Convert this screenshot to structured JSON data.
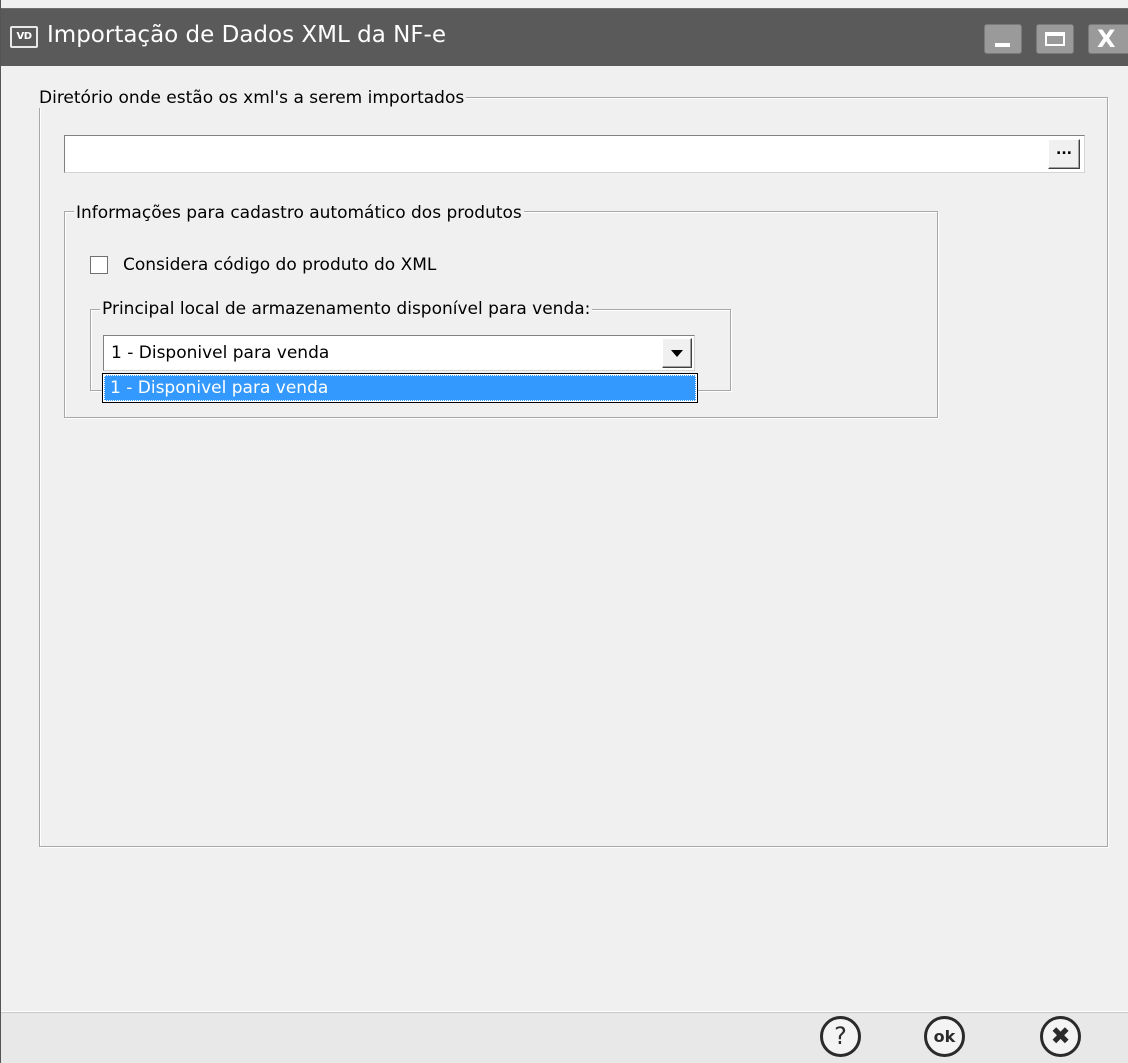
{
  "window": {
    "app_icon_text": "VD",
    "title": "Importação de Dados XML da NF-e",
    "close_glyph": "X"
  },
  "directory_group": {
    "legend": "Diretório onde estão os xml's a serem importados",
    "path_value": "",
    "browse_label": "..."
  },
  "products_group": {
    "legend": "Informações para cadastro automático dos produtos",
    "checkbox_label": "Considera código do produto do XML",
    "checkbox_checked": false,
    "storage_group": {
      "legend": "Principal local de armazenamento disponível para venda:",
      "selected_value": "1 - Disponivel para venda",
      "options": [
        "1 - Disponivel para venda"
      ]
    }
  },
  "footer": {
    "help_label": "?",
    "ok_label": "ok",
    "cancel_label": "✖"
  },
  "icons": {
    "app": "vd-app-icon",
    "minimize": "minimize-icon",
    "maximize": "maximize-icon",
    "close": "close-icon",
    "dropdown": "chevron-down-icon",
    "help": "help-icon",
    "ok": "ok-icon",
    "cancel": "cancel-icon"
  },
  "colors": {
    "titlebar": "#5a5a5a",
    "selection": "#3399ff",
    "window_bg": "#f0f0f0"
  }
}
